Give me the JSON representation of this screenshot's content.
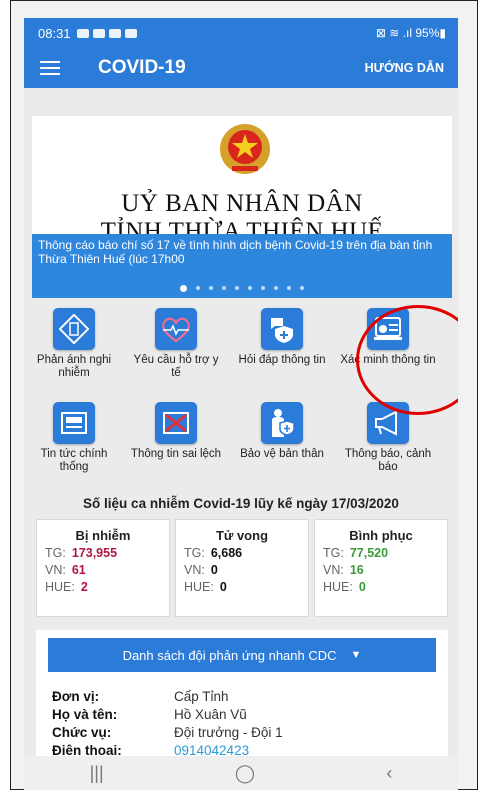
{
  "status": {
    "time": "08:31",
    "right": "⊠ ≋ .ıl 95%▮"
  },
  "appbar": {
    "title": "COVID-19",
    "guide": "HƯỚNG DẪN"
  },
  "banner": {
    "line1": "UỶ BAN NHÂN DÂN",
    "line2": "TỈNH THỪA THIÊN HUẾ",
    "caption": "Thông cáo báo chí số 17 về tình hình dịch bệnh Covid-19 trên địa bàn tỉnh Thừa Thiên Huế (lúc 17h00",
    "active_dot": 0,
    "dot_count": 10
  },
  "tiles": [
    {
      "label": "Phản ánh nghi nhiễm",
      "icon": "clipboard-icon"
    },
    {
      "label": "Yêu cầu hỗ trợ y tế",
      "icon": "heart-sos-icon"
    },
    {
      "label": "Hỏi đáp thông tin",
      "icon": "chat-shield-icon"
    },
    {
      "label": "Xác minh thông tin",
      "icon": "verify-card-icon"
    },
    {
      "label": "Tin tức chính thống",
      "icon": "newspaper-icon"
    },
    {
      "label": "Thông tin sai lệch",
      "icon": "crossed-document-icon"
    },
    {
      "label": "Bảo vệ bản thân",
      "icon": "person-shield-icon"
    },
    {
      "label": "Thông báo, cảnh báo",
      "icon": "megaphone-icon"
    }
  ],
  "stats": {
    "title": "Số liệu ca nhiễm Covid-19 lũy kế ngày 17/03/2020",
    "cards": [
      {
        "title": "Bị nhiễm",
        "color": "#b0163f",
        "tg_label": "TG:",
        "tg": "173,955",
        "vn_label": "VN:",
        "vn": "61",
        "hue_label": "HUE:",
        "hue": "2"
      },
      {
        "title": "Tử vong",
        "color": "#111111",
        "tg_label": "TG:",
        "tg": "6,686",
        "vn_label": "VN:",
        "vn": "0",
        "hue_label": "HUE:",
        "hue": "0"
      },
      {
        "title": "Bình phục",
        "color": "#3b9a3b",
        "tg_label": "TG:",
        "tg": "77,520",
        "vn_label": "VN:",
        "vn": "16",
        "hue_label": "HUE:",
        "hue": "0"
      }
    ]
  },
  "cdc": {
    "button": "Danh sách đội phản ứng nhanh CDC",
    "caret": "▼",
    "rows": [
      {
        "key": "Đơn vị:",
        "value": "Cấp Tỉnh"
      },
      {
        "key": "Họ và tên:",
        "value": "Hồ Xuân Vũ"
      },
      {
        "key": "Chức vụ:",
        "value": "Đội trưởng - Đội 1"
      },
      {
        "key": "Điện thoai:",
        "value": "0914042423"
      }
    ],
    "phone_color": "#2b9bd9"
  },
  "navbar": {
    "recents": "|||",
    "home": "◯",
    "back": "‹"
  }
}
